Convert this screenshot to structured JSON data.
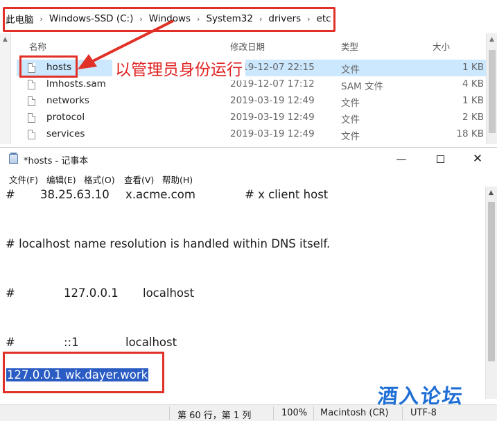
{
  "explorer": {
    "breadcrumb": [
      "此电脑",
      "Windows-SSD (C:)",
      "Windows",
      "System32",
      "drivers",
      "etc"
    ],
    "columns": {
      "name": "名称",
      "date": "修改日期",
      "type": "类型",
      "size": "大小"
    },
    "files": [
      {
        "name": "hosts",
        "date": "2019-12-07 22:15",
        "type": "文件",
        "size": "1 KB"
      },
      {
        "name": "lmhosts.sam",
        "date": "2019-12-07 17:12",
        "type": "SAM 文件",
        "size": "4 KB"
      },
      {
        "name": "networks",
        "date": "2019-03-19 12:49",
        "type": "文件",
        "size": "1 KB"
      },
      {
        "name": "protocol",
        "date": "2019-03-19 12:49",
        "type": "文件",
        "size": "2 KB"
      },
      {
        "name": "services",
        "date": "2019-03-19 12:49",
        "type": "文件",
        "size": "18 KB"
      }
    ],
    "annotation": "以管理员身份运行"
  },
  "notepad": {
    "title": "*hosts - 记事本",
    "window_buttons": {
      "minimize": "—",
      "close": "✕"
    },
    "menu": [
      "文件(F)",
      "编辑(E)",
      "格式(O)",
      "查看(V)",
      "帮助(H)"
    ],
    "lines": {
      "l1_hash": "#",
      "l1_ip": "38.25.63.10",
      "l1_host": "x.acme.com",
      "l1_comment": "# x client host",
      "l2": "# localhost name resolution is handled within DNS itself.",
      "l3_hash": "#",
      "l3_ip": "127.0.0.1",
      "l3_host": "localhost",
      "l4_hash": "#",
      "l4_ip": "::1",
      "l4_host": "localhost",
      "l5_selected": "127.0.0.1 wk.dayer.work"
    },
    "status": {
      "position": "第 60 行，第 1 列",
      "zoom": "100%",
      "eol": "Macintosh (CR)",
      "encoding": "UTF-8"
    }
  },
  "watermark": "酒入论坛",
  "colors": {
    "annotation_red": "#e03028",
    "selection_blue": "#2a5cc4",
    "row_selected": "#cce8ff",
    "watermark_blue": "#1f6fd6"
  }
}
